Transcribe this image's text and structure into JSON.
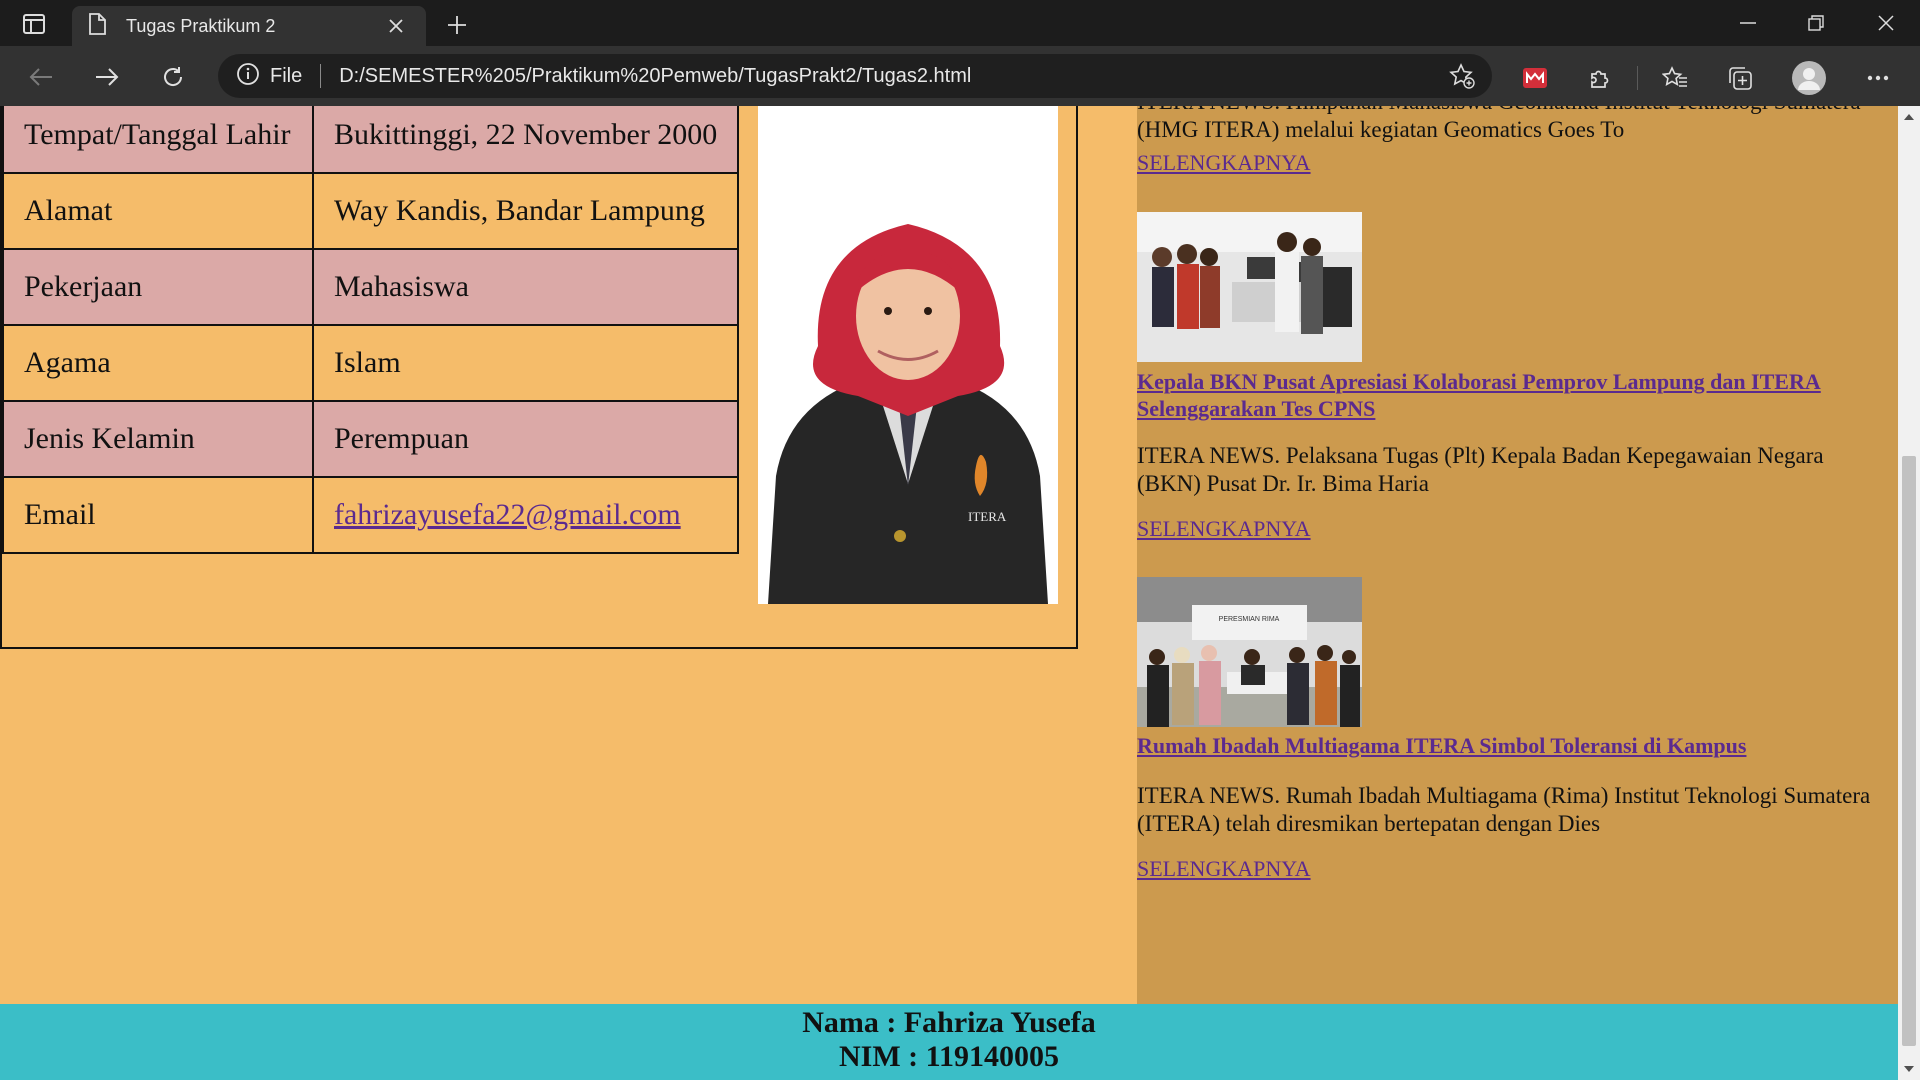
{
  "browser": {
    "tab_title": "Tugas Praktikum 2",
    "omnibox": {
      "scheme_label": "File",
      "url": "D:/SEMESTER%205/Praktikum%20Pemweb/TugasPrakt2/Tugas2.html"
    }
  },
  "icons": [
    "tab-actions-icon",
    "page-icon",
    "close-icon",
    "plus-icon",
    "minimize-icon",
    "restore-icon",
    "window-close-icon",
    "back-arrow-icon",
    "forward-arrow-icon",
    "refresh-icon",
    "info-icon",
    "add-favorite-icon",
    "extension-badge-icon",
    "puzzle-icon",
    "favorites-icon",
    "collections-icon",
    "profile-avatar-icon",
    "more-icon"
  ],
  "colors": {
    "page_bg": "#f5bc6a",
    "pink_row": "#dba9a7",
    "news_bg": "#cc9a4e",
    "footer_bg": "#3bbec7",
    "link": "#5b2a8f"
  },
  "biodata": {
    "rows": [
      {
        "label": "Tempat/Tanggal Lahir",
        "value": "Bukittinggi, 22 November 2000"
      },
      {
        "label": "Alamat",
        "value": "Way Kandis, Bandar Lampung"
      },
      {
        "label": "Pekerjaan",
        "value": "Mahasiswa"
      },
      {
        "label": "Agama",
        "value": "Islam"
      },
      {
        "label": "Jenis Kelamin",
        "value": "Perempuan"
      },
      {
        "label": "Email",
        "value": "fahrizayusefa22@gmail.com"
      }
    ],
    "photo_text": "ITERA"
  },
  "news": {
    "top_cut_text": "ITERA NEWS. Himpunan Mahasiswa Geomatika Institut Teknologi Sumatera (HMG ITERA) melalui kegiatan Geomatics Goes To",
    "more_label": "SELENGKAPNYA",
    "items": [
      {
        "title": "Kepala BKN Pusat Apresiasi Kolaborasi Pemprov Lampung dan ITERA Selenggarakan Tes CPNS",
        "desc": "ITERA NEWS. Pelaksana Tugas (Plt) Kepala Badan Kepegawaian Negara (BKN) Pusat Dr. Ir. Bima Haria",
        "more": "SELENGKAPNYA"
      },
      {
        "title": "Rumah Ibadah Multiagama ITERA Simbol Toleransi di Kampus",
        "banner_text": "PERESMIAN RIMA",
        "desc": "ITERA NEWS. Rumah Ibadah Multiagama (Rima) Institut Teknologi Sumatera (ITERA) telah diresmikan bertepatan dengan Dies",
        "more": "SELENGKAPNYA"
      }
    ]
  },
  "footer": {
    "name_line": "Nama : Fahriza Yusefa",
    "nim_line": "NIM : 119140005"
  }
}
